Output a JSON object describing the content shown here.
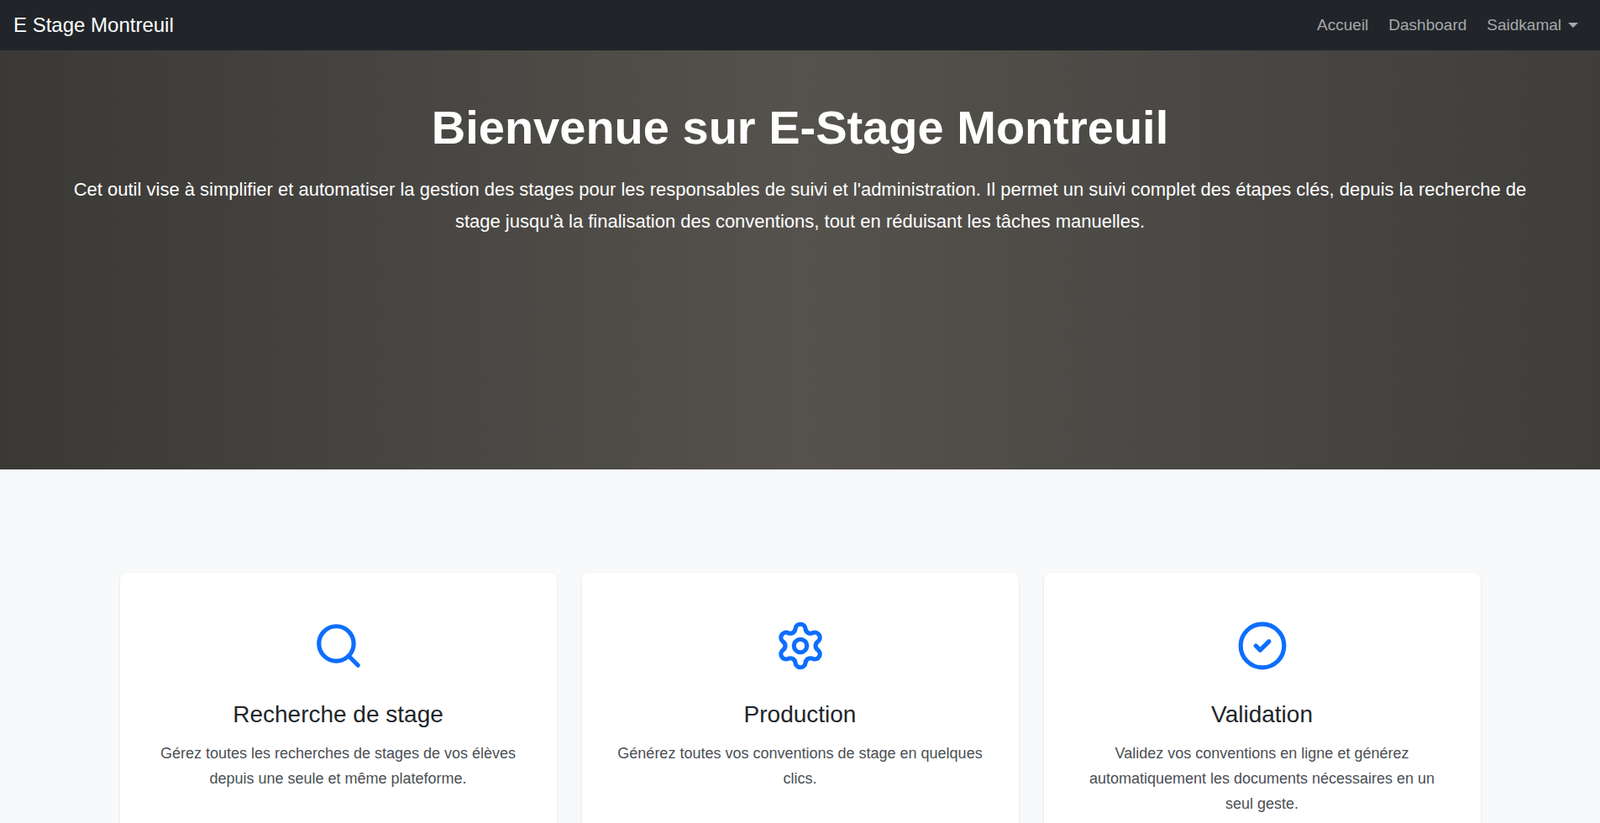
{
  "navbar": {
    "brand": "E Stage Montreuil",
    "links": [
      {
        "label": "Accueil"
      },
      {
        "label": "Dashboard"
      }
    ],
    "user_menu": {
      "label": "Saidkamal",
      "expanded": false
    }
  },
  "hero": {
    "title": "Bienvenue sur E-Stage Montreuil",
    "text": "Cet outil vise à simplifier et automatiser la gestion des stages pour les responsables de suivi et l'administration. Il permet un suivi complet des étapes clés, depuis la recherche de stage jusqu'à la finalisation des conventions, tout en réduisant les tâches manuelles."
  },
  "features": [
    {
      "title": "Recherche de stage",
      "description": "Gérez toutes les recherches de stages de vos élèves depuis une seule et même plateforme."
    },
    {
      "title": "Production",
      "description": "Générez toutes vos conventions de stage en quelques clics."
    },
    {
      "title": "Validation",
      "description": "Validez vos conventions en ligne et générez automatiquement les documents nécessaires en un seul geste."
    }
  ]
}
